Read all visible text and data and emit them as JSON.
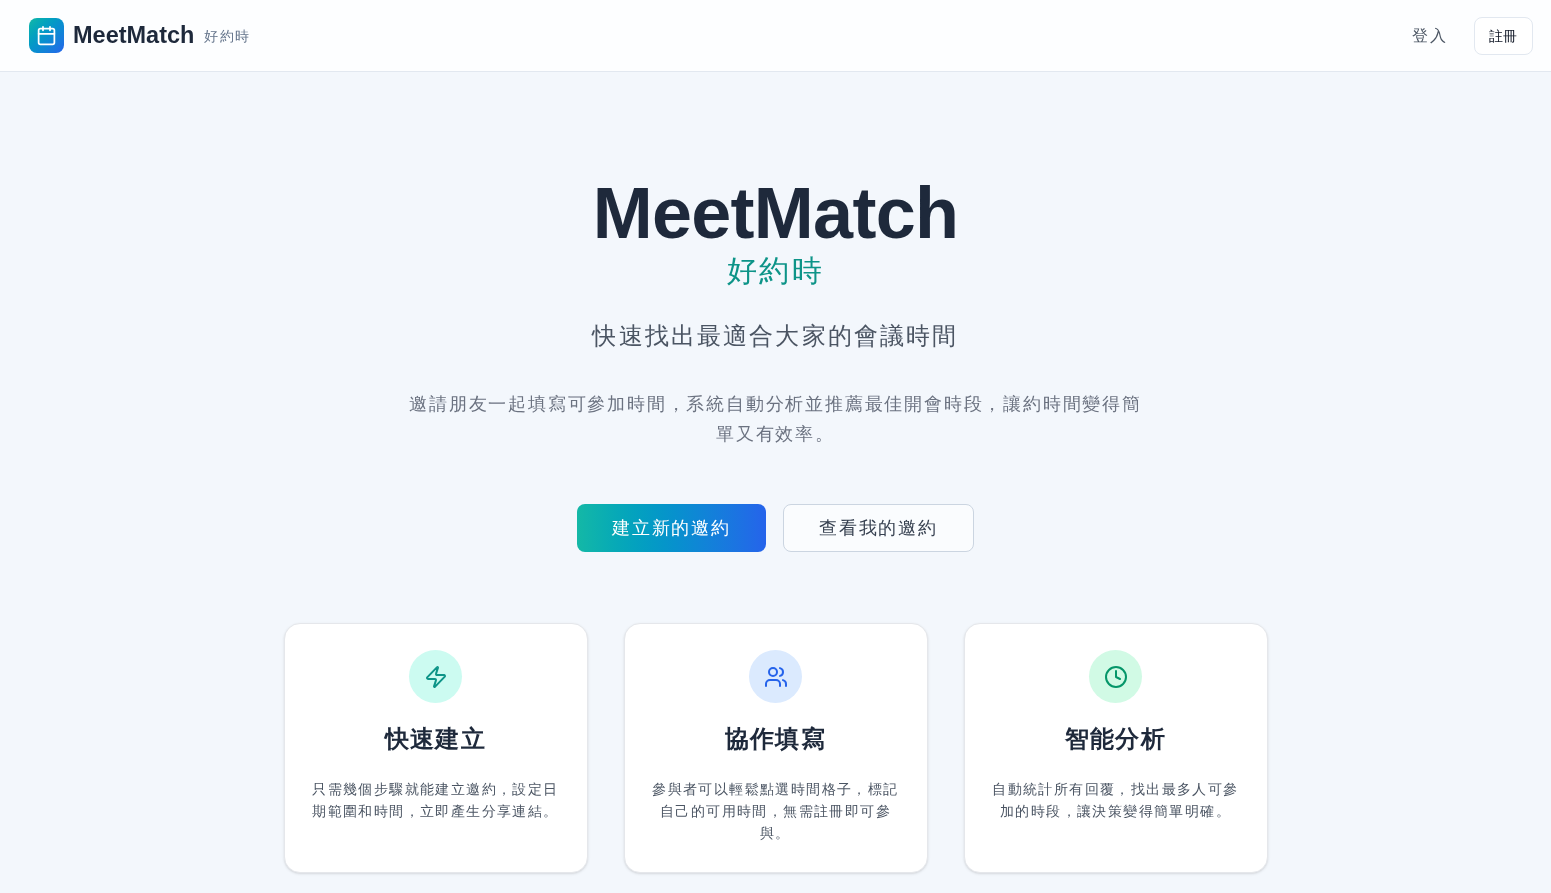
{
  "header": {
    "brand": "MeetMatch",
    "brand_subtitle": "好約時",
    "login": "登入",
    "signup": "註冊"
  },
  "hero": {
    "title": "MeetMatch",
    "subtitle": "好約時",
    "tagline": "快速找出最適合大家的會議時間",
    "description": "邀請朋友一起填寫可參加時間，系統自動分析並推薦最佳開會時段，讓約時間變得簡單又有效率。",
    "buttons": [
      {
        "label": "建立新的邀約",
        "kind": "primary"
      },
      {
        "label": "查看我的邀約",
        "kind": "secondary"
      }
    ]
  },
  "features": [
    {
      "title": "快速建立",
      "description": "只需幾個步驟就能建立邀約，設定日期範圍和時間，立即產生分享連結。",
      "color": "#ccfbf1"
    },
    {
      "title": "協作填寫",
      "description": "參與者可以輕鬆點選時間格子，標記自己的可用時間，無需註冊即可參與。",
      "color": "#dbeafe"
    },
    {
      "title": "智能分析",
      "description": "自動統計所有回覆，找出最多人可參加的時段，讓決策變得簡單明確。",
      "color": "#d1fae5"
    }
  ]
}
